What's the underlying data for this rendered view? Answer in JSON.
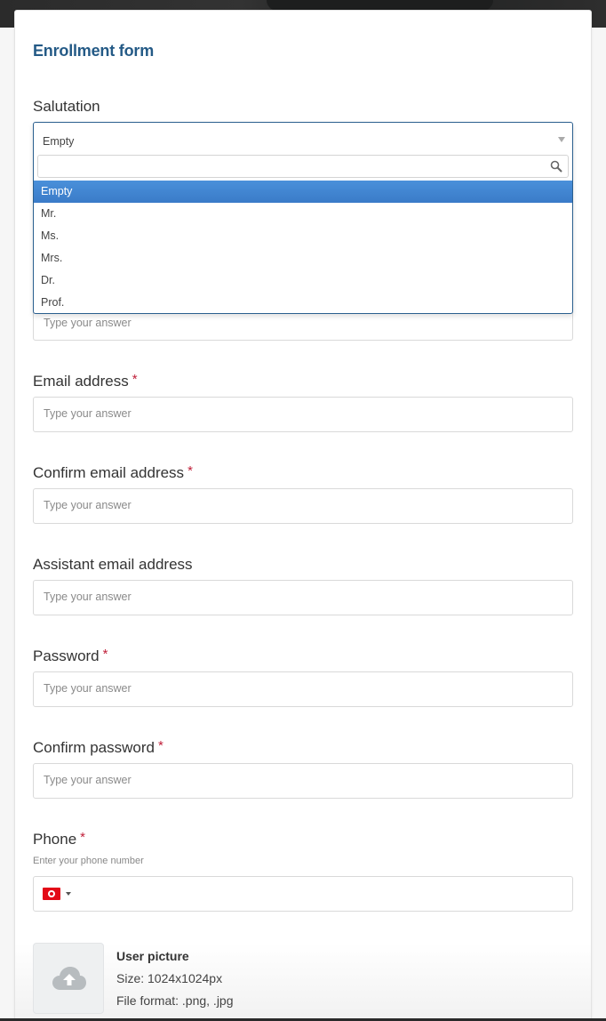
{
  "form": {
    "title": "Enrollment form",
    "placeholder": "Type your answer",
    "required_marker": "*"
  },
  "salutation": {
    "label": "Salutation",
    "selected": "Empty",
    "search_value": "",
    "options": [
      {
        "label": "Empty",
        "selected": true
      },
      {
        "label": "Mr.",
        "selected": false
      },
      {
        "label": "Ms.",
        "selected": false
      },
      {
        "label": "Mrs.",
        "selected": false
      },
      {
        "label": "Dr.",
        "selected": false
      },
      {
        "label": "Prof.",
        "selected": false
      }
    ]
  },
  "fields": [
    {
      "id": "hidden-field",
      "label": "",
      "required": false,
      "placeholder": "Type your answer",
      "value": ""
    },
    {
      "id": "email",
      "label": "Email address",
      "required": true,
      "placeholder": "Type your answer",
      "value": ""
    },
    {
      "id": "confirm-email",
      "label": "Confirm email address",
      "required": true,
      "placeholder": "Type your answer",
      "value": ""
    },
    {
      "id": "assistant-email",
      "label": "Assistant email address",
      "required": false,
      "placeholder": "Type your answer",
      "value": ""
    },
    {
      "id": "password",
      "label": "Password",
      "required": true,
      "placeholder": "Type your answer",
      "value": ""
    },
    {
      "id": "confirm-password",
      "label": "Confirm password",
      "required": true,
      "placeholder": "Type your answer",
      "value": ""
    }
  ],
  "phone": {
    "label": "Phone",
    "required": true,
    "hint": "Enter your phone number",
    "country_flag": "Tunisia",
    "value": ""
  },
  "upload": {
    "title": "User picture",
    "size": "Size: 1024x1024px",
    "format": "File format: .png, .jpg",
    "icon": "cloud-upload-icon"
  },
  "colors": {
    "title": "#245a86",
    "required": "#c0203a",
    "selected_option": "#3a7bc8",
    "focus_border": "#2a5f8f"
  }
}
